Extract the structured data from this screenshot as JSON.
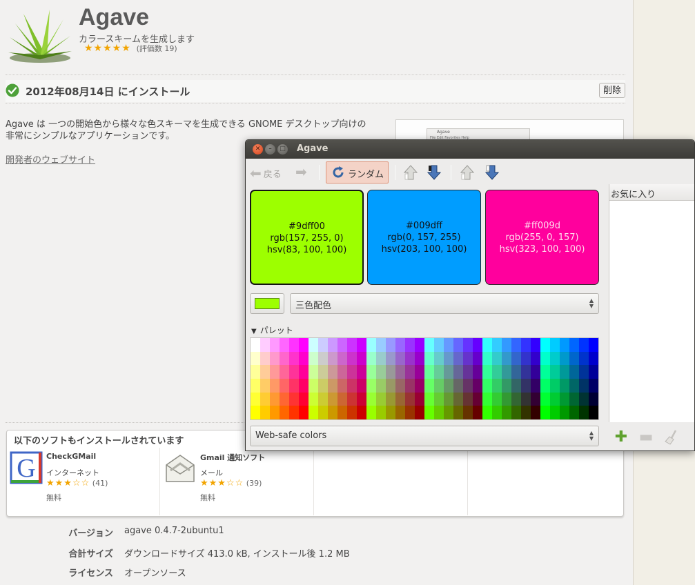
{
  "app": {
    "name": "Agave",
    "description": "カラースキームを生成します",
    "stars": "★★★★★",
    "rating_count": "(評価数 19)"
  },
  "install": {
    "status": "2012年08月14日 にインストール",
    "remove_label": "削除"
  },
  "body": {
    "description_line1": "Agave は 一つの開始色から様々な色スキーマを生成できる GNOME デスクトップ向けの",
    "description_line2": "非常にシンプルなアプリケーションです。",
    "developer_link": "開発者のウェブサイト"
  },
  "thumbnail": {
    "title": "Agave",
    "menu": "File Edit Favorites Help"
  },
  "also_installed": {
    "title": "以下のソフトもインストールされています",
    "items": [
      {
        "name": "CheckGMail",
        "category": "インターネット",
        "stars": "★★★☆☆",
        "count": "(41)",
        "price": "無料",
        "icon": "gmail-g-icon"
      },
      {
        "name": "Gmail 通知ソフト",
        "category": "メール",
        "stars": "★★★☆☆",
        "count": "(39)",
        "price": "無料",
        "icon": "mail-envelope-icon"
      }
    ]
  },
  "details": [
    {
      "label": "バージョン",
      "value": "agave 0.4.7-2ubuntu1"
    },
    {
      "label": "合計サイズ",
      "value": "ダウンロードサイズ 413.0 kB, インストール後 1.2 MB"
    },
    {
      "label": "ライセンス",
      "value": "オープンソース"
    }
  ],
  "agave_window": {
    "title": "Agave",
    "toolbar": {
      "back_label": "戻る",
      "random_label": "ランダム"
    },
    "swatches": [
      {
        "hex": "#9dff00",
        "rgb": "rgb(157, 255, 0)",
        "hsv": "hsv(83, 100, 100)"
      },
      {
        "hex": "#009dff",
        "rgb": "rgb(0, 157, 255)",
        "hsv": "hsv(203, 100, 100)"
      },
      {
        "hex": "#ff009d",
        "rgb": "rgb(255, 0, 157)",
        "hsv": "hsv(323, 100, 100)"
      }
    ],
    "base_color": "#9dff00",
    "scheme_value": "三色配色",
    "palette_label": "パレット",
    "palette_value": "Web-safe colors",
    "favorites_label": "お気に入り"
  },
  "colors": {
    "accent_star": "#f2a400",
    "random_button_bg": "#f4d3c7",
    "titlebar": "#3c3b37"
  }
}
